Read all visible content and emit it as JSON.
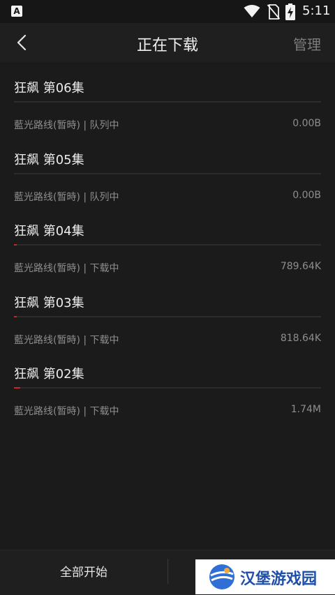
{
  "status_bar": {
    "app_icon_letter": "A",
    "time": "5:11",
    "icons": [
      "wifi-icon",
      "no-sim-icon",
      "battery-charging-icon"
    ]
  },
  "header": {
    "back_icon": "chevron-left-icon",
    "title": "正在下载",
    "manage_label": "管理"
  },
  "downloads": [
    {
      "title": "狂飙 第06集",
      "source": "藍光路线(暂時)",
      "status": "队列中",
      "size": "0.00B",
      "progress": 0
    },
    {
      "title": "狂飙 第05集",
      "source": "藍光路线(暂時)",
      "status": "队列中",
      "size": "0.00B",
      "progress": 0
    },
    {
      "title": "狂飙 第04集",
      "source": "藍光路线(暂時)",
      "status": "下载中",
      "size": "789.64K",
      "progress": 0.01
    },
    {
      "title": "狂飙 第03集",
      "source": "藍光路线(暂時)",
      "status": "下载中",
      "size": "818.64K",
      "progress": 0.01
    },
    {
      "title": "狂飙 第02集",
      "source": "藍光路线(暂時)",
      "status": "下载中",
      "size": "1.74M",
      "progress": 0.02
    }
  ],
  "bottom_bar": {
    "start_all_label": "全部开始"
  },
  "watermark": {
    "text": "汉堡游戏园"
  },
  "colors": {
    "progress": "#c62828",
    "background": "#1b1b1b",
    "header": "#1f1f1f"
  }
}
